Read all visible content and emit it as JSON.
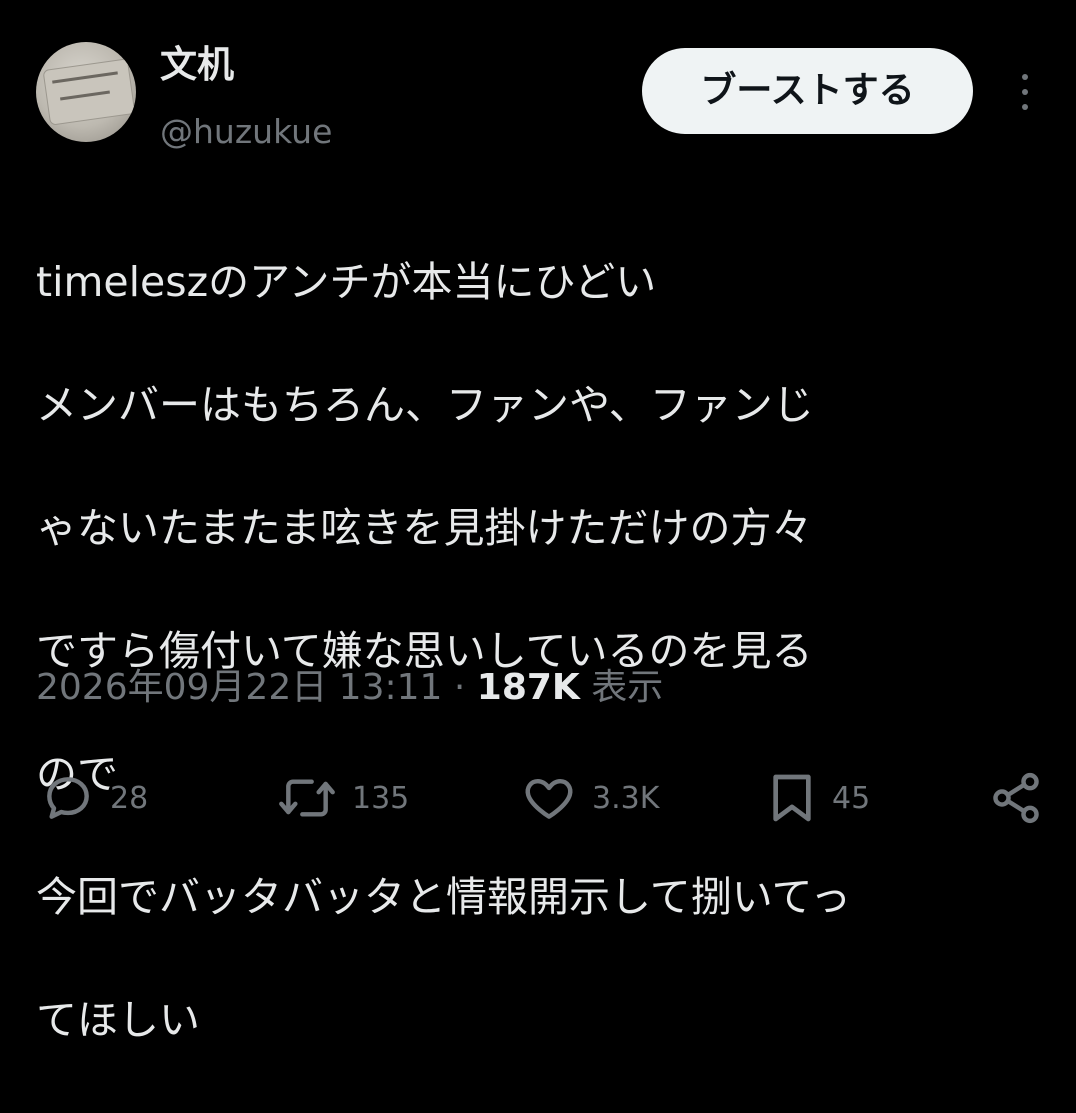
{
  "user": {
    "display_name": "文机",
    "handle": "@huzukue",
    "avatar_icon": "avatar-image"
  },
  "header": {
    "follow_label": "ブーストする",
    "more_icon": "more-vertical-icon"
  },
  "tweet": {
    "text": "timeleszのアンチが本当にひどい\nメンバーはもちろん、ファンや、ファンじゃないたまたま呟きを見掛けただけの方々ですら傷付いて嫌な思いしているのを見るので\n今回でバッタバッタと情報開示して捌いてってほしい",
    "lines": [
      "timeleszのアンチが本当にひどい",
      "メンバーはもちろん、ファンや、ファンじ",
      "ゃないたまたま呟きを見掛けただけの方々",
      "ですら傷付いて嫌な思いしているのを見る",
      "ので",
      "今回でバッタバッタと情報開示して捌いてっ",
      "てほしい"
    ]
  },
  "meta": {
    "timestamp": "2026年09月22日 13:11",
    "separator": " · ",
    "views_count": "187K",
    "views_label": " 表示"
  },
  "actions": {
    "reply": {
      "icon": "reply-icon",
      "count": "28"
    },
    "repost": {
      "icon": "repost-icon",
      "count": "135"
    },
    "like": {
      "icon": "heart-icon",
      "count": "3.3K"
    },
    "bookmark": {
      "icon": "bookmark-icon",
      "count": "45"
    },
    "share": {
      "icon": "share-icon"
    }
  },
  "colors": {
    "background": "#000000",
    "text_primary": "#e7e9ea",
    "text_secondary": "#71767b",
    "button_bg": "#eff3f4"
  }
}
